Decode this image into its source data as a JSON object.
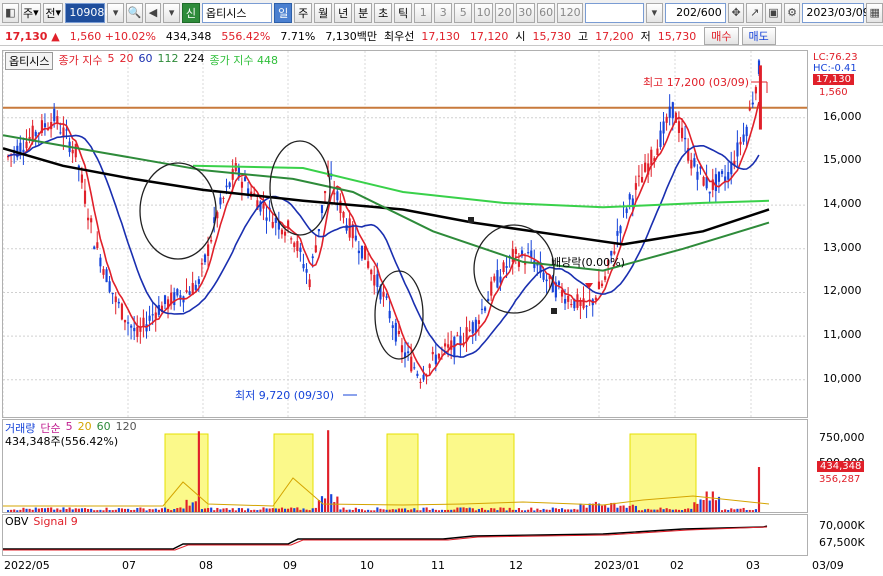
{
  "toolbar": {
    "period_select": "주",
    "market_select": "전",
    "code": "109080",
    "new_badge": "신",
    "stock_name": "옵티시스",
    "period_tabs": [
      "일",
      "주",
      "월",
      "년",
      "분",
      "초",
      "틱"
    ],
    "active_period": "일",
    "interval_tabs": [
      "1",
      "3",
      "5",
      "10",
      "20",
      "30",
      "60",
      "120"
    ],
    "bar_count": "202/600",
    "date": "2023/03/09"
  },
  "quote": {
    "price": "17,130 ▲",
    "change": "1,560 +10.02%",
    "volume": "434,348",
    "volume_ratio": "556.42%",
    "turnover": "7.71%",
    "amount": "7,130백만",
    "best_ask_label": "최우선",
    "best_ask": "17,130",
    "best_bid": "17,120",
    "open_label": "시",
    "open": "15,730",
    "high_label": "고",
    "high": "17,200",
    "low_label": "저",
    "low": "15,730",
    "buy_button": "매수",
    "sell_button": "매도"
  },
  "price_panel": {
    "name": "옵티시스",
    "ma_label": "종가 지수",
    "ma_periods": [
      "5",
      "20",
      "60",
      "112",
      "224"
    ],
    "ma_long_label": "종가 지수 448",
    "right_top": [
      "LC:76.23",
      "HC:-0.41"
    ],
    "current_price_tag": "17,130",
    "change_tag": "1,560",
    "high_annotation": "최고 17,200 (03/09)",
    "low_annotation": "최저 9,720 (09/30)",
    "dividend_annotation": "배당락(0.00%)",
    "y_ticks": [
      "16,000",
      "15,000",
      "14,000",
      "13,000",
      "12,000",
      "11,000",
      "10,000"
    ],
    "colors": {
      "up": "#e0202a",
      "down": "#1744d9",
      "ma5": "#e0202a",
      "ma20": "#1a2fb0",
      "ma60": "#2e8b3a",
      "ma112": "#000000",
      "ma224": "#39d14a",
      "resistance": "#c87a3c"
    }
  },
  "volume_panel": {
    "label": "거래량",
    "ma_label": "단순",
    "ma_periods": [
      "5",
      "20",
      "60",
      "120"
    ],
    "value_line": "434,348주(556.42%)",
    "y_ticks": [
      "750,000",
      "500,000"
    ],
    "current_tag": "434,348",
    "ma_tag": "356,287"
  },
  "obv_panel": {
    "label": "OBV",
    "signal_label": "Signal 9",
    "y_ticks": [
      "70,000K",
      "67,500K"
    ]
  },
  "x_axis": {
    "labels": [
      "2022/05",
      "07",
      "08",
      "09",
      "10",
      "11",
      "12",
      "2023/01",
      "02",
      "03",
      "03/09"
    ]
  }
}
